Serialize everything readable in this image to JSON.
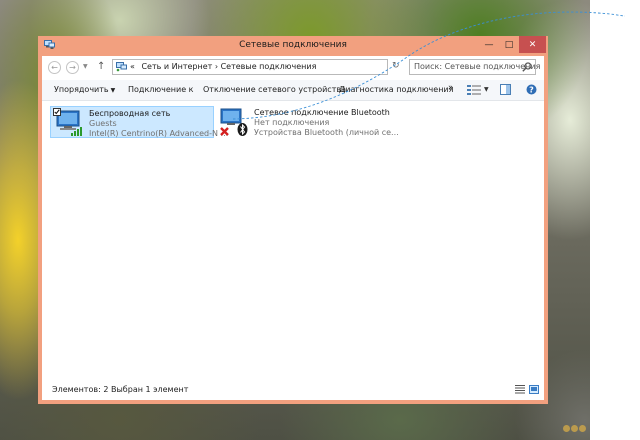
{
  "window": {
    "title": "Сетевые подключения",
    "minimize_label": "—",
    "maximize_label": "□",
    "close_label": "✕"
  },
  "address_bar": {
    "prefix": "«",
    "path": [
      "Сеть и Интернет",
      "Сетевые подключения"
    ],
    "separator": "›",
    "path_text": "Сеть и Интернет  ›  Сетевые подключения",
    "search_placeholder": "Поиск: Сетевые подключения"
  },
  "command_bar": {
    "organize": "Упорядочить",
    "connect": "Подключение к",
    "disable": "Отключение сетевого устройства",
    "diagnose": "Диагностика подключения",
    "more": "»"
  },
  "connections": [
    {
      "name": "Беспроводная сеть",
      "status": "Guests",
      "device": "Intel(R) Centrino(R) Advanced-N ...",
      "selected": true
    },
    {
      "name": "Сетевое подключение Bluetooth",
      "status": "Нет подключения",
      "device": "Устройства Bluetooth (личной се...",
      "selected": false
    }
  ],
  "status_bar": {
    "count": "Элементов: 2",
    "selection": "Выбран 1 элемент"
  },
  "colors": {
    "window_frame": "#f2a07f",
    "selection_bg": "#cce8ff",
    "close_button": "#c75050"
  }
}
